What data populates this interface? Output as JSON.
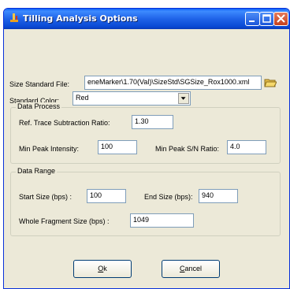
{
  "window": {
    "title": "Tilling Analysis Options"
  },
  "size_standard": {
    "label": "Size Standard File:",
    "value": "eneMarker\\1.70(Val)\\SizeStd\\SGSize_Rox1000.xml"
  },
  "standard_color": {
    "label": "Standard Color:",
    "value": "Red"
  },
  "data_process": {
    "title": "Data Process",
    "ref_trace_label": "Ref. Trace Subtraction Ratio:",
    "ref_trace_value": "1.30",
    "min_peak_label": "Min Peak Intensity:",
    "min_peak_value": "100",
    "min_sn_label": "Min Peak S/N Ratio:",
    "min_sn_value": "4.0"
  },
  "data_range": {
    "title": "Data Range",
    "start_label": "Start Size (bps) :",
    "start_value": "100",
    "end_label": "End Size (bps):",
    "end_value": "940",
    "whole_label": "Whole Fragment Size (bps) :",
    "whole_value": "1049"
  },
  "buttons": {
    "ok_mnemonic": "O",
    "ok_rest": "k",
    "cancel_mnemonic": "C",
    "cancel_rest": "ancel"
  },
  "icons": {
    "app": "tilling-app-icon",
    "browse": "open-folder-icon"
  },
  "colors": {
    "titlebar": "#0a5ef7",
    "dialog_bg": "#ece9d8",
    "close_btn": "#c5401d"
  }
}
